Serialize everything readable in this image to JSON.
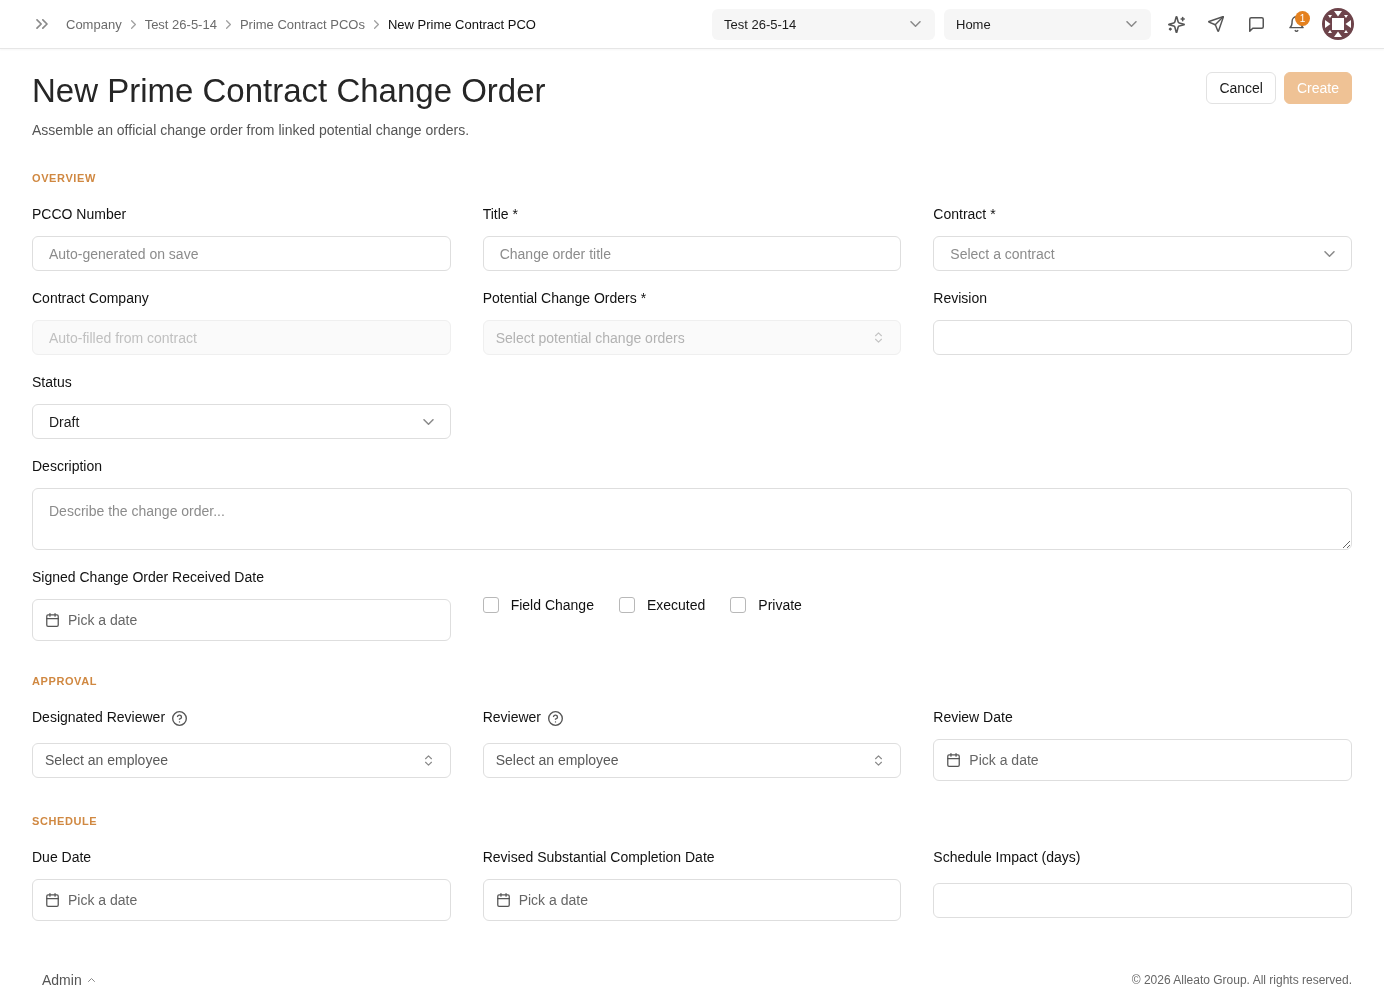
{
  "topbar": {
    "breadcrumb": [
      {
        "label": "Company",
        "current": false
      },
      {
        "label": "Test 26-5-14",
        "current": false
      },
      {
        "label": "Prime Contract PCOs",
        "current": false
      },
      {
        "label": "New Prime Contract PCO",
        "current": true
      }
    ],
    "selects": [
      {
        "value": "Test 26-5-14"
      },
      {
        "value": "Home"
      }
    ],
    "notifications": {
      "count": "1"
    }
  },
  "page": {
    "title": "New Prime Contract Change Order",
    "subtitle": "Assemble an official change order from linked potential change orders.",
    "actions": [
      {
        "label": "Cancel",
        "kind": "secondary",
        "disabled": false
      },
      {
        "label": "Create",
        "kind": "primary",
        "disabled": true
      }
    ]
  },
  "sections": [
    {
      "heading": "OVERVIEW",
      "fields": [
        {
          "kind": "text",
          "label": "PCCO Number",
          "placeholder": "Auto-generated on save",
          "disabled": false
        },
        {
          "kind": "text",
          "label": "Title *",
          "placeholder": "Change order title",
          "disabled": false
        },
        {
          "kind": "select",
          "label": "Contract *",
          "placeholder": "Select a contract",
          "disabled": false
        },
        {
          "kind": "text",
          "label": "Contract Company",
          "placeholder": "Auto-filled from contract",
          "disabled": true
        },
        {
          "kind": "combobox",
          "label": "Potential Change Orders *",
          "placeholder": "Select potential change orders",
          "disabled": true
        },
        {
          "kind": "text",
          "label": "Revision",
          "disabled": false
        },
        {
          "kind": "select",
          "label": "Status",
          "value": "Draft",
          "disabled": false
        },
        {
          "kind": "textarea",
          "label": "Description",
          "placeholder": "Describe the change order..."
        },
        {
          "kind": "date",
          "label": "Signed Change Order Received Date",
          "placeholder": "Pick a date"
        },
        {
          "kind": "checkboxes",
          "options": [
            {
              "label": "Field Change",
              "checked": false
            },
            {
              "label": "Executed",
              "checked": false
            },
            {
              "label": "Private",
              "checked": false
            }
          ]
        }
      ]
    },
    {
      "heading": "APPROVAL",
      "fields": [
        {
          "kind": "combobox",
          "label": "Designated Reviewer",
          "help": true,
          "placeholder": "Select an employee",
          "disabled": false
        },
        {
          "kind": "combobox",
          "label": "Reviewer",
          "help": true,
          "placeholder": "Select an employee",
          "disabled": false
        },
        {
          "kind": "date",
          "label": "Review Date",
          "help": false,
          "placeholder": "Pick a date"
        }
      ]
    },
    {
      "heading": "SCHEDULE",
      "fields": [
        {
          "kind": "date",
          "label": "Due Date",
          "placeholder": "Pick a date"
        },
        {
          "kind": "date",
          "label": "Revised Substantial Completion Date",
          "placeholder": "Pick a date"
        },
        {
          "kind": "text",
          "label": "Schedule Impact (days)",
          "disabled": false
        }
      ]
    }
  ],
  "footer": {
    "user_menu": {
      "label": "Admin"
    },
    "copyright": "© 2026 Alleato Group. All rights reserved."
  }
}
